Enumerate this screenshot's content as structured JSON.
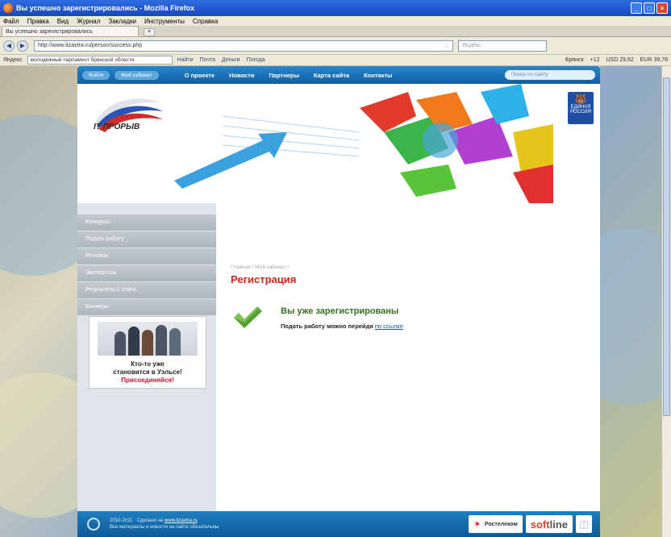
{
  "window": {
    "title": "Вы успешно зарегистрировались - Mozilla Firefox",
    "controls": {
      "minimize": "_",
      "maximize": "□",
      "close": "×"
    }
  },
  "menubar": [
    "Файл",
    "Правка",
    "Вид",
    "Журнал",
    "Закладки",
    "Инструменты",
    "Справка"
  ],
  "tab": {
    "label": "Вы успешно зарегистрировались"
  },
  "navbar": {
    "url": "http://www.itzavtra.ru/person/success.php",
    "search_placeholder": "Яндекс"
  },
  "yandexbar": {
    "label": "Яндекс",
    "input": "молодежный парламент брянской области",
    "items": [
      "Найти",
      "Почта",
      "Деньги",
      "Погода"
    ],
    "right": [
      "Брянск",
      "+12",
      "USD 29,62",
      "EUR 39,78"
    ]
  },
  "site": {
    "topnav": {
      "pills": [
        "Войти",
        "Мой кабинет"
      ],
      "links": [
        "О проекте",
        "Новости",
        "Партнеры",
        "Карта сайта",
        "Контакты"
      ],
      "search_placeholder": "Поиск по сайту"
    },
    "logo_text": "IT ПРОРЫВ",
    "party_label": "ЕДИНАЯ РОССИЯ",
    "sidebar": {
      "items": [
        "Конкурсы",
        "Подать работу",
        "Регионы",
        "Экспертизы",
        "Результаты 1 этапа",
        "Баннеры"
      ],
      "promo": {
        "line1": "Кто-то уже",
        "line2": "становится в Уэльсе!",
        "cta": "Присоединяйся!"
      }
    },
    "breadcrumb": "Главная / Мой кабинет /",
    "page_title": "Регистрация",
    "success": {
      "heading": "Вы уже зарегистрированы",
      "note": "Подать работу можно перейдя",
      "link": "по ссылке"
    },
    "footer": {
      "line1": "2010-2011 · Сделано на",
      "line1_link": "www.itzavtra.ru",
      "line2": "Все материалы и новости на сайте обязательны",
      "partner1": "Ростелеком",
      "partner2_a": "soft",
      "partner2_b": "line"
    }
  },
  "colors": {
    "accent": "#0f5fa6",
    "title_red": "#d2241a",
    "success_green": "#3a6f20"
  }
}
